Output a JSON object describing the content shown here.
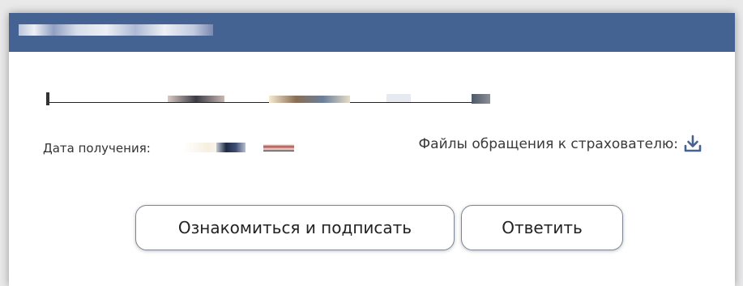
{
  "header": {
    "title_redacted": true
  },
  "document": {
    "name_redacted": true
  },
  "info": {
    "received_label": "Дата получения:",
    "files_label": "Файлы обращения к страхователю:",
    "download_icon": "download-icon"
  },
  "actions": {
    "sign_label": "Ознакомиться и подписать",
    "reply_label": "Ответить"
  },
  "colors": {
    "header_bg": "#456392",
    "icon": "#456392",
    "button_border": "#7e8594"
  }
}
